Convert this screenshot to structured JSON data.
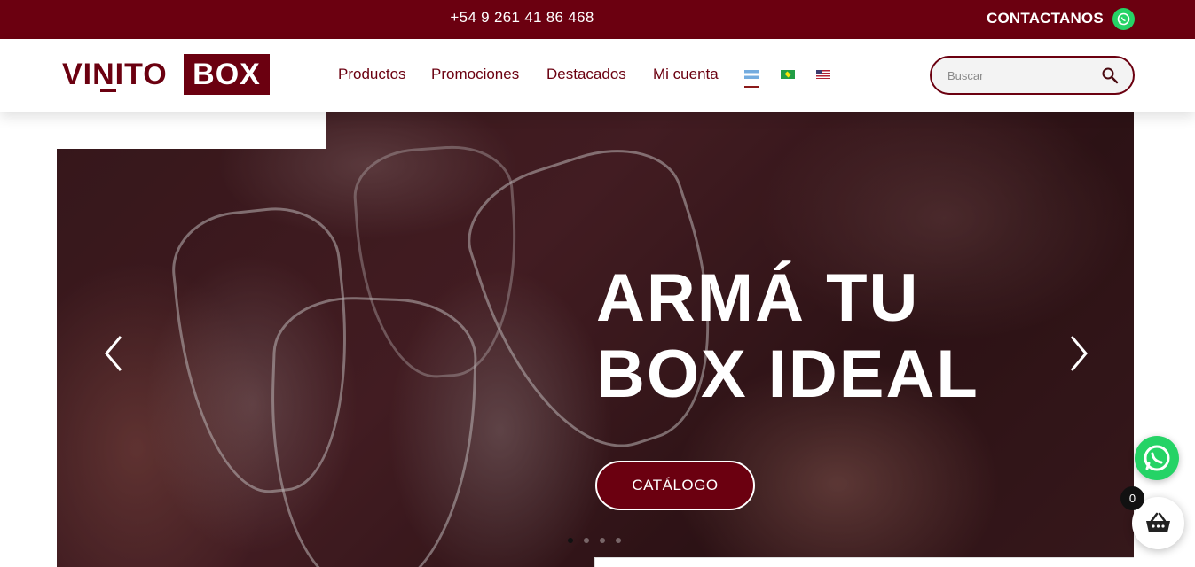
{
  "topbar": {
    "phone": "+54 9 261 41 86 468",
    "contact_label": "CONTACTANOS",
    "whatsapp_icon": "whatsapp-icon"
  },
  "header": {
    "logo": {
      "left_text": "VINITO",
      "box_text": "BOX"
    },
    "nav": [
      {
        "label": "Productos"
      },
      {
        "label": "Promociones"
      },
      {
        "label": "Destacados"
      },
      {
        "label": "Mi cuenta"
      }
    ],
    "languages": [
      {
        "code": "es-AR",
        "icon": "flag-argentina-icon",
        "selected": true
      },
      {
        "code": "pt-BR",
        "icon": "flag-brazil-icon",
        "selected": false
      },
      {
        "code": "en-US",
        "icon": "flag-usa-icon",
        "selected": false
      }
    ],
    "search": {
      "placeholder": "Buscar",
      "value": "",
      "icon": "search-icon"
    }
  },
  "hero": {
    "title_line1": "ARMÁ TU",
    "title_line2": "BOX IDEAL",
    "cta_label": "CATÁLOGO",
    "slide_count": 4,
    "active_slide": 1
  },
  "widgets": {
    "whatsapp_icon": "whatsapp-icon",
    "cart_icon": "basket-icon",
    "cart_count": "0"
  },
  "colors": {
    "brand": "#6b0010",
    "whatsapp": "#25d366",
    "white": "#ffffff"
  }
}
